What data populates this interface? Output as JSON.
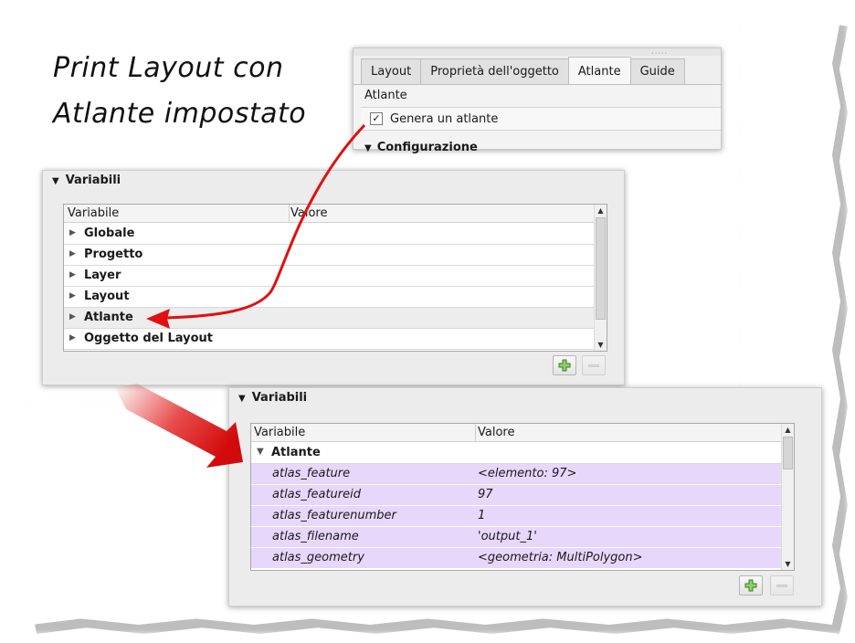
{
  "title": {
    "line1": "Print Layout con",
    "line2": "Atlante impostato"
  },
  "tabs_panel": {
    "grip": "·····",
    "tabs": [
      "Layout",
      "Proprietà dell'oggetto",
      "Atlante",
      "Guide"
    ],
    "active_tab": "Atlante",
    "section_label": "Atlante",
    "generate_checkbox": {
      "label": "Genera un atlante",
      "checked": true,
      "mark": "✓"
    },
    "config_label": "Configurazione"
  },
  "variables_panel_1": {
    "header": "Variabili",
    "columns": [
      "Variabile",
      "Valore"
    ],
    "groups": [
      "Globale",
      "Progetto",
      "Layer",
      "Layout",
      "Atlante",
      "Oggetto del Layout"
    ],
    "highlighted_group": "Atlante"
  },
  "variables_panel_2": {
    "header": "Variabili",
    "columns": [
      "Variabile",
      "Valore"
    ],
    "expanded_group": "Atlante",
    "rows": [
      {
        "name": "atlas_feature",
        "value": "<elemento: 97>"
      },
      {
        "name": "atlas_featureid",
        "value": "97"
      },
      {
        "name": "atlas_featurenumber",
        "value": "1"
      },
      {
        "name": "atlas_filename",
        "value": "'output_1'"
      },
      {
        "name": "atlas_geometry",
        "value": "<geometria: MultiPolygon>"
      }
    ]
  },
  "colors": {
    "arrow": "#e01010",
    "atlas_row_bg": "#e7d7fb",
    "panel_bg": "#ececec"
  },
  "icons": {
    "collapse": "triangle-down-icon",
    "expand": "triangle-right-icon",
    "add": "plus-icon",
    "remove": "minus-icon"
  }
}
